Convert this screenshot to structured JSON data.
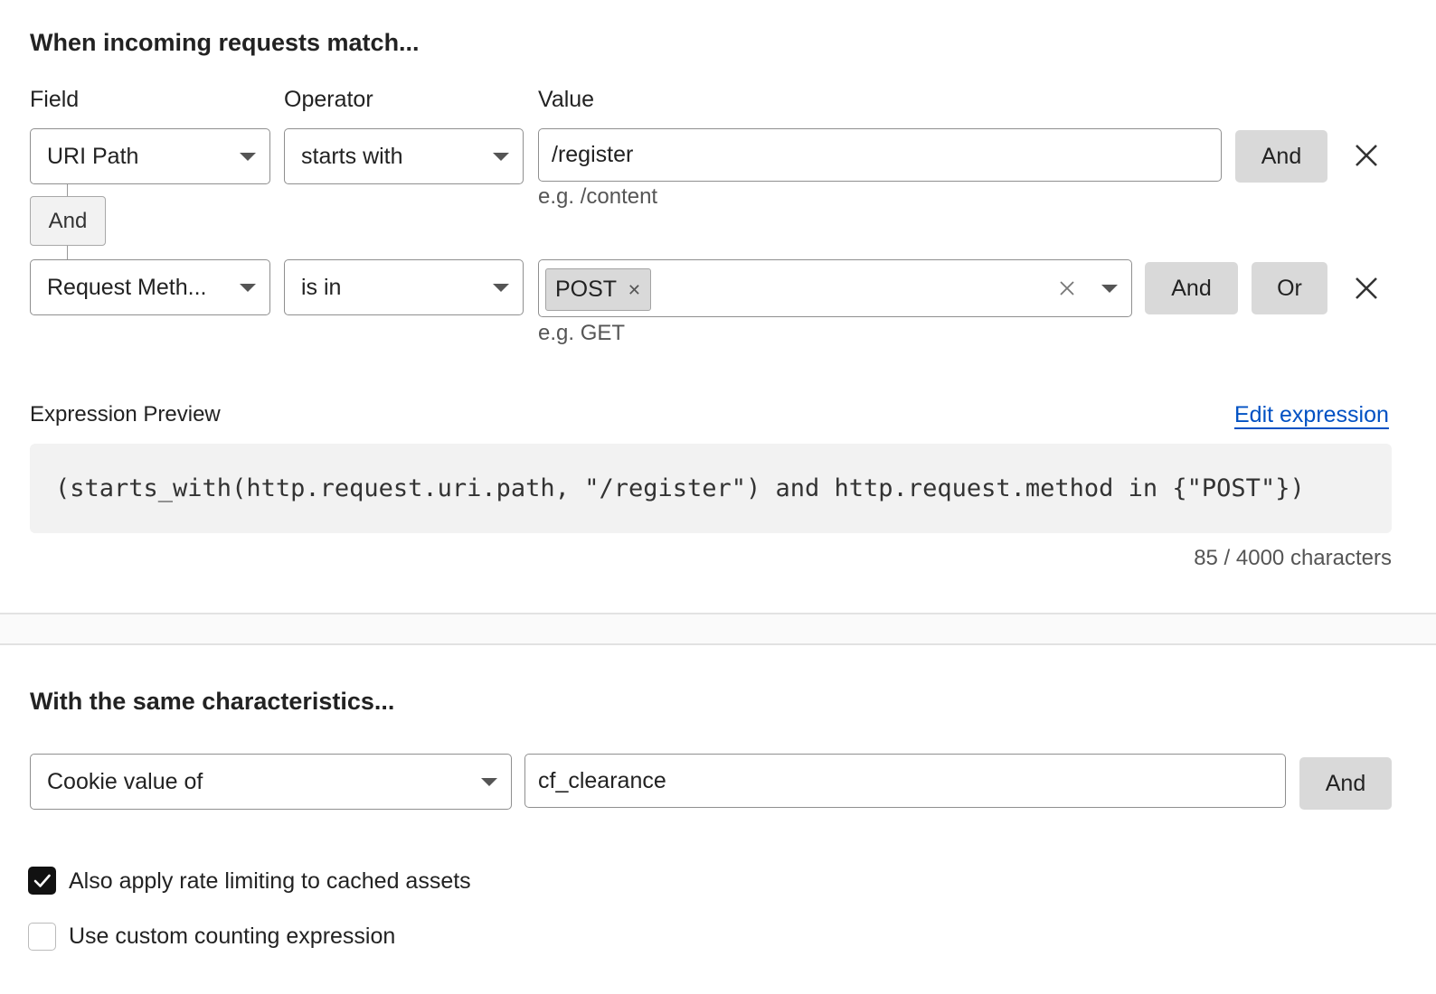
{
  "match_section": {
    "title": "When incoming requests match...",
    "columns": {
      "field": "Field",
      "operator": "Operator",
      "value": "Value"
    },
    "rows": [
      {
        "field": "URI Path",
        "operator": "starts with",
        "value": "/register",
        "hint": "e.g. /content",
        "buttons": [
          "And"
        ]
      },
      {
        "field": "Request Meth...",
        "operator": "is in",
        "chips": [
          "POST"
        ],
        "hint": "e.g. GET",
        "buttons": [
          "And",
          "Or"
        ]
      }
    ],
    "connector": "And"
  },
  "expression": {
    "label": "Expression Preview",
    "edit_link": "Edit expression",
    "text": "(starts_with(http.request.uri.path, \"/register\") and http.request.method in {\"POST\"})",
    "counter": "85 / 4000 characters"
  },
  "characteristics": {
    "title": "With the same characteristics...",
    "select": "Cookie value of",
    "value": "cf_clearance",
    "button": "And"
  },
  "options": [
    {
      "label": "Also apply rate limiting to cached assets",
      "checked": true
    },
    {
      "label": "Use custom counting expression",
      "checked": false
    }
  ],
  "colors": {
    "link": "#0051c3",
    "button_bg": "#d9d9d9",
    "preview_bg": "#f2f2f2",
    "checkbox_checked": "#111111"
  }
}
